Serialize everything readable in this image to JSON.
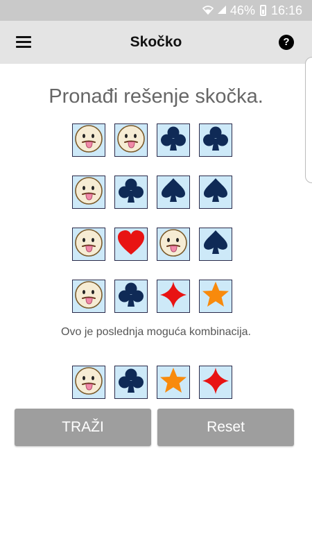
{
  "status_bar": {
    "battery": "46%",
    "time": "16:16"
  },
  "app_bar": {
    "title": "Skočko",
    "help_glyph": "?"
  },
  "headline": "Pronađi rešenje skočka.",
  "colors": {
    "tile_bg": "#cde9f8",
    "navy": "#0f2a56",
    "red": "#e81313",
    "orange": "#f88a0c",
    "smiley_face": "#f6ecd4"
  },
  "board": {
    "guesses": [
      [
        "skocko-icon",
        "skocko-icon",
        "club-icon",
        "club-icon"
      ],
      [
        "skocko-icon",
        "club-icon",
        "spade-icon",
        "spade-icon"
      ],
      [
        "skocko-icon",
        "heart-icon",
        "skocko-icon",
        "spade-icon"
      ],
      [
        "skocko-icon",
        "club-icon",
        "diamond-icon",
        "star-icon"
      ]
    ],
    "message": "Ovo je poslednja moguća kombinacija.",
    "solution": [
      "skocko-icon",
      "club-icon",
      "star-icon",
      "diamond-icon"
    ]
  },
  "buttons": {
    "search": "TRAŽI",
    "reset": "Reset"
  }
}
